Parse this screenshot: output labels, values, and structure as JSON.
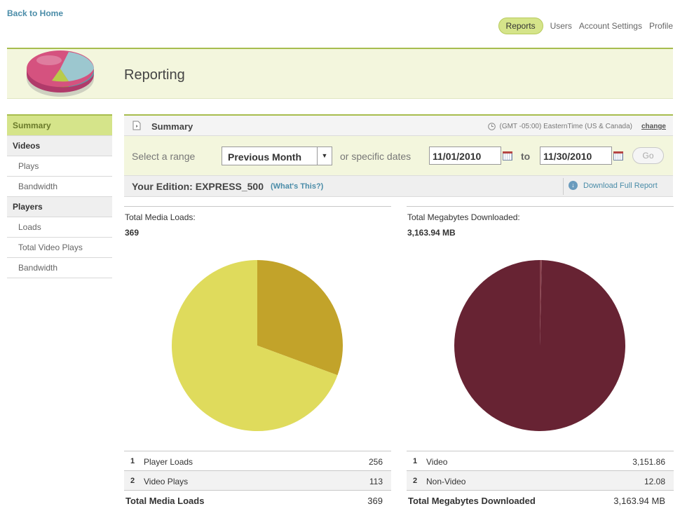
{
  "header": {
    "back_link": "Back to Home",
    "nav": [
      "Reports",
      "Users",
      "Account Settings",
      "Profile"
    ],
    "active_nav": "Reports"
  },
  "banner": {
    "title": "Reporting"
  },
  "sidebar": {
    "items": [
      {
        "label": "Summary",
        "type": "selected"
      },
      {
        "label": "Videos",
        "type": "section"
      },
      {
        "label": "Plays",
        "type": "sub"
      },
      {
        "label": "Bandwidth",
        "type": "sub"
      },
      {
        "label": "Players",
        "type": "section"
      },
      {
        "label": "Loads",
        "type": "sub"
      },
      {
        "label": "Total Video Plays",
        "type": "sub"
      },
      {
        "label": "Bandwidth",
        "type": "sub"
      }
    ]
  },
  "summary_bar": {
    "title": "Summary",
    "timezone": "(GMT -05:00) EasternTime (US & Canada)",
    "change_link": "change"
  },
  "range": {
    "select_label": "Select a range",
    "selected_range": "Previous Month",
    "or_label": "or specific dates",
    "start_date": "11/01/2010",
    "to_label": "to",
    "end_date": "11/30/2010",
    "go_label": "Go"
  },
  "edition": {
    "label": "Your Edition: EXPRESS_500",
    "whats_this": "(What's This?)",
    "download_label": "Download Full Report"
  },
  "panels": {
    "media_loads": {
      "metric_label": "Total Media Loads:",
      "metric_value": "369",
      "rows": [
        {
          "num": "1",
          "name": "Player Loads",
          "amount": "256"
        },
        {
          "num": "2",
          "name": "Video Plays",
          "amount": "113"
        }
      ],
      "total_label": "Total Media Loads",
      "total_value": "369"
    },
    "megabytes": {
      "metric_label": "Total Megabytes Downloaded:",
      "metric_value": "3,163.94 MB",
      "rows": [
        {
          "num": "1",
          "name": "Video",
          "amount": "3,151.86"
        },
        {
          "num": "2",
          "name": "Non-Video",
          "amount": "12.08"
        }
      ],
      "total_label": "Total Megabytes Downloaded",
      "total_value": "3,163.94 MB"
    }
  },
  "chart_data": [
    {
      "type": "pie",
      "categories": [
        "Player Loads",
        "Video Plays"
      ],
      "values": [
        256,
        113
      ],
      "colors": [
        "#dfdb5c",
        "#c2a32a"
      ]
    },
    {
      "type": "pie",
      "categories": [
        "Video",
        "Non-Video"
      ],
      "values": [
        3151.86,
        12.08
      ],
      "colors": [
        "#672333",
        "#8a4450"
      ]
    }
  ]
}
